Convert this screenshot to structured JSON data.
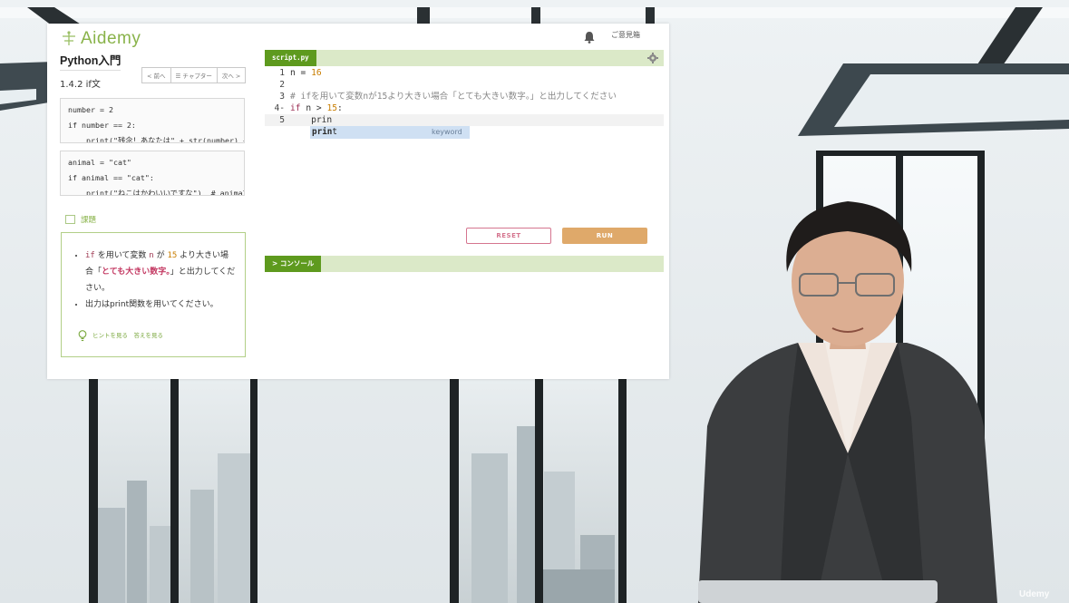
{
  "brand": {
    "logo_text": "Aidemy",
    "accent_color": "#89b34a"
  },
  "header": {
    "feedback_label": "ご意見箱",
    "bell_icon": "bell-icon"
  },
  "course": {
    "title": "Python入門",
    "lesson": "1.4.2 if文",
    "nav": {
      "prev": "< 前へ",
      "chapter": "☰ チャプター",
      "next": "次へ >"
    }
  },
  "examples": [
    {
      "lines": [
        "number = 2",
        "if number == 2:",
        "    print(\"残念！あなたは\" + str(number) +"
      ]
    },
    {
      "lines": [
        "animal = \"cat\"",
        "if animal == \"cat\":",
        "    print(\"ねこはかわいいですな\")  # animalの"
      ]
    }
  ],
  "task": {
    "heading": "課題",
    "bullet1": {
      "p1": "if",
      "p2": " を用いて変数 ",
      "p3": "n",
      "p4": " が ",
      "p5": "15",
      "p6": " より大きい場合「",
      "p7": "とても大きい数字。",
      "p8": "」と出力してください。"
    },
    "bullet2": "出力はprint関数を用いてください。",
    "hint_links": "ヒントを見る　答えを見る"
  },
  "editor": {
    "file_tab": "script.py",
    "lines": [
      {
        "num": "1",
        "pre": "n = ",
        "val": "16"
      },
      {
        "num": "2",
        "pre": ""
      },
      {
        "num": "3",
        "cmt": "# ifを用いて変数nが15より大きい場合「とても大きい数字。」と出力してください"
      },
      {
        "num": "4-",
        "kw": "if",
        "pre": " n > ",
        "val": "15",
        "post": ":"
      },
      {
        "num": "5",
        "pre": "    prin"
      }
    ],
    "autocomplete": {
      "match": "prin",
      "rest": "t",
      "type": "keyword"
    },
    "reset_label": "RESET",
    "run_label": "RUN",
    "console_label": "> コンソール"
  },
  "watermark": "Udemy"
}
